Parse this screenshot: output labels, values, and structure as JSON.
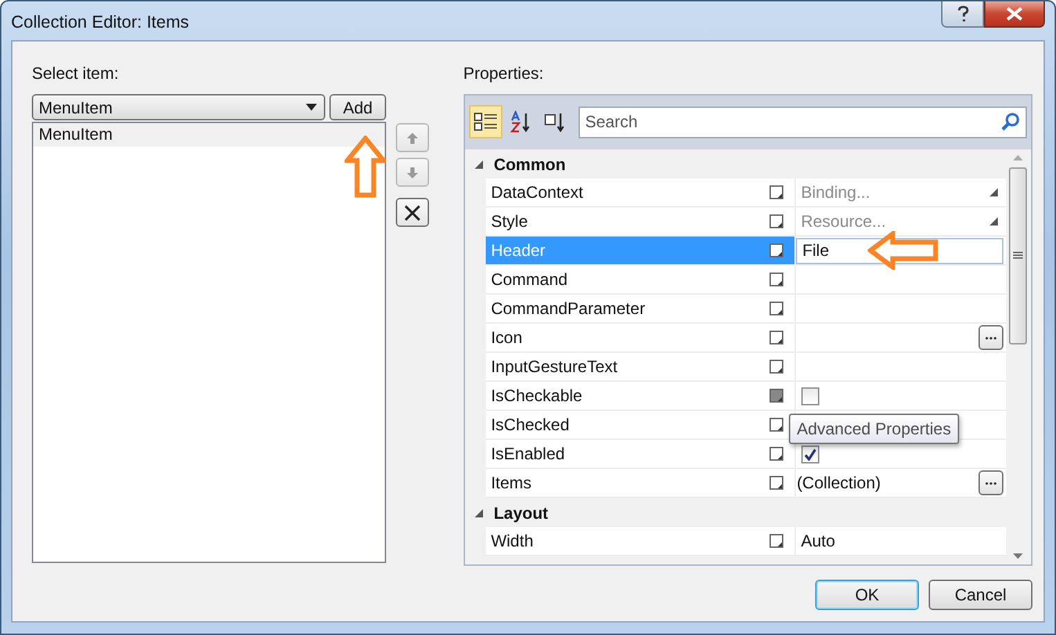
{
  "window": {
    "title": "Collection Editor: Items"
  },
  "select_item": {
    "label": "Select item:",
    "type_value": "MenuItem",
    "add_button": "Add",
    "items": [
      {
        "label": "MenuItem",
        "selected": true
      }
    ]
  },
  "properties": {
    "label": "Properties:",
    "search": {
      "placeholder": "Search"
    },
    "categories": [
      {
        "name": "Common",
        "expanded": true,
        "rows": [
          {
            "name": "DataContext",
            "kind": "hint",
            "value": "Binding...",
            "selected": false,
            "marker_filled": false,
            "browse": false
          },
          {
            "name": "Style",
            "kind": "hint",
            "value": "Resource...",
            "selected": false,
            "marker_filled": false,
            "browse": false
          },
          {
            "name": "Header",
            "kind": "text",
            "value": "File",
            "selected": true,
            "marker_filled": false,
            "browse": false
          },
          {
            "name": "Command",
            "kind": "empty",
            "selected": false,
            "marker_filled": false,
            "browse": false
          },
          {
            "name": "CommandParameter",
            "kind": "empty",
            "selected": false,
            "marker_filled": false,
            "browse": false
          },
          {
            "name": "Icon",
            "kind": "empty",
            "selected": false,
            "marker_filled": false,
            "browse": true
          },
          {
            "name": "InputGestureText",
            "kind": "empty",
            "selected": false,
            "marker_filled": false,
            "browse": false
          },
          {
            "name": "IsCheckable",
            "kind": "checkbox",
            "checked": false,
            "selected": false,
            "marker_filled": true,
            "browse": false
          },
          {
            "name": "IsChecked",
            "kind": "empty",
            "selected": false,
            "marker_filled": false,
            "browse": false
          },
          {
            "name": "IsEnabled",
            "kind": "checkbox",
            "checked": true,
            "selected": false,
            "marker_filled": false,
            "browse": false
          },
          {
            "name": "Items",
            "kind": "plain",
            "value": "(Collection)",
            "selected": false,
            "marker_filled": false,
            "browse": true
          }
        ]
      },
      {
        "name": "Layout",
        "expanded": true,
        "rows": [
          {
            "name": "Width",
            "kind": "text",
            "value": "Auto",
            "selected": false,
            "marker_filled": false,
            "browse": false
          }
        ]
      }
    ],
    "tooltip": "Advanced Properties"
  },
  "buttons": [
    {
      "label": "OK",
      "default": true
    },
    {
      "label": "Cancel",
      "default": false
    }
  ]
}
